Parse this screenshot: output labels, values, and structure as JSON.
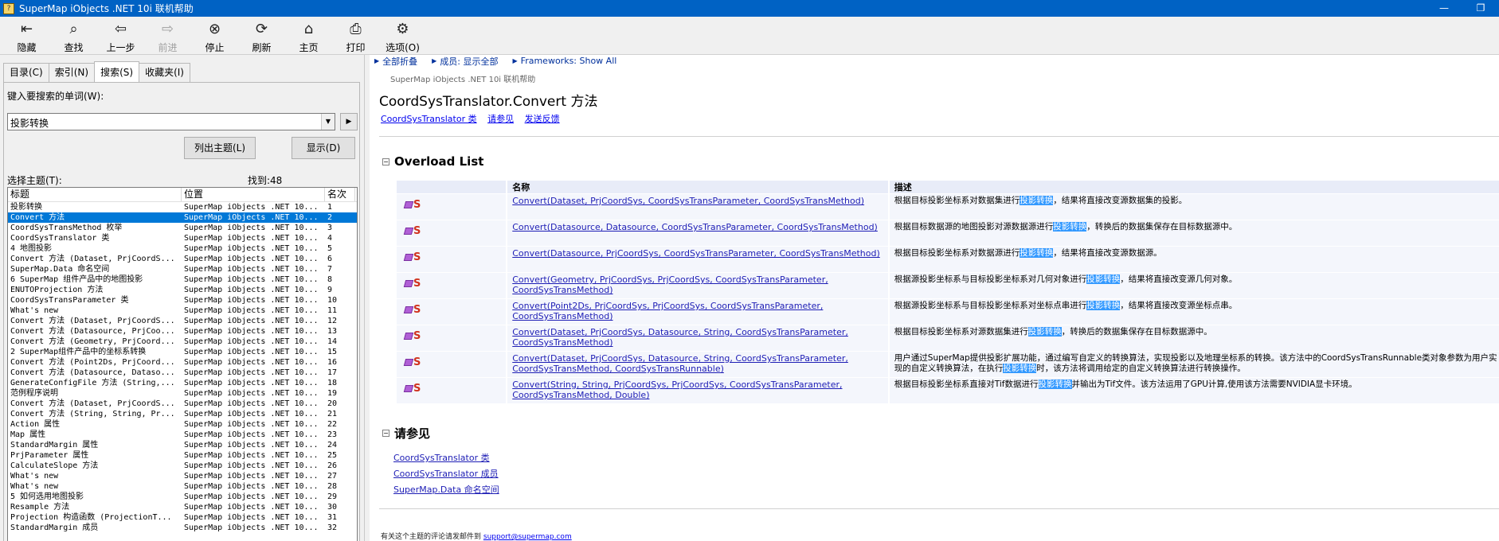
{
  "window": {
    "title": "SuperMap iObjects .NET 10i 联机帮助",
    "controls": [
      "minimize",
      "restore"
    ]
  },
  "toolbar": [
    {
      "id": "hide",
      "label": "隐藏",
      "icon": "hide-icon",
      "glyph": "⇤",
      "enabled": true
    },
    {
      "id": "find",
      "label": "查找",
      "icon": "find-icon",
      "glyph": "⌕",
      "enabled": true
    },
    {
      "id": "back",
      "label": "上一步",
      "icon": "back-arrow-icon",
      "glyph": "⇦",
      "enabled": true
    },
    {
      "id": "forward",
      "label": "前进",
      "icon": "forward-arrow-icon",
      "glyph": "⇨",
      "enabled": false
    },
    {
      "id": "stop",
      "label": "停止",
      "icon": "stop-icon",
      "glyph": "⊗",
      "enabled": true
    },
    {
      "id": "refresh",
      "label": "刷新",
      "icon": "refresh-icon",
      "glyph": "⟳",
      "enabled": true
    },
    {
      "id": "home",
      "label": "主页",
      "icon": "home-icon",
      "glyph": "⌂",
      "enabled": true
    },
    {
      "id": "print",
      "label": "打印",
      "icon": "print-icon",
      "glyph": "⎙",
      "enabled": true
    },
    {
      "id": "options",
      "label": "选项(O)",
      "icon": "options-icon",
      "glyph": "⚙",
      "enabled": true
    }
  ],
  "left": {
    "tabs": [
      {
        "label": "目录(C)",
        "active": false
      },
      {
        "label": "索引(N)",
        "active": false
      },
      {
        "label": "搜索(S)",
        "active": true
      },
      {
        "label": "收藏夹(I)",
        "active": false
      }
    ],
    "keyword_label": "键入要搜索的单词(W):",
    "keyword_value": "投影转换",
    "list_topics_button": "列出主题(L)",
    "display_button": "显示(D)",
    "select_topic_label": "选择主题(T):",
    "found_label": "找到:48",
    "columns": [
      "标题",
      "位置",
      "名次"
    ],
    "results": [
      {
        "title": "投影转换",
        "location": "SuperMap iObjects .NET 10...",
        "rank": "1"
      },
      {
        "title": "Convert 方法",
        "location": "SuperMap iObjects .NET 10...",
        "rank": "2",
        "selected": true
      },
      {
        "title": "CoordSysTransMethod 枚举",
        "location": "SuperMap iObjects .NET 10...",
        "rank": "3"
      },
      {
        "title": "CoordSysTranslator 类",
        "location": "SuperMap iObjects .NET 10...",
        "rank": "4"
      },
      {
        "title": "4 地图投影",
        "location": "SuperMap iObjects .NET 10...",
        "rank": "5"
      },
      {
        "title": "Convert 方法 (Dataset, PrjCoordS...",
        "location": "SuperMap iObjects .NET 10...",
        "rank": "6"
      },
      {
        "title": "SuperMap.Data 命名空间",
        "location": "SuperMap iObjects .NET 10...",
        "rank": "7"
      },
      {
        "title": "6 SuperMap 组件产品中的地图投影",
        "location": "SuperMap iObjects .NET 10...",
        "rank": "8"
      },
      {
        "title": "ENUTOProjection 方法",
        "location": "SuperMap iObjects .NET 10...",
        "rank": "9"
      },
      {
        "title": "CoordSysTransParameter 类",
        "location": "SuperMap iObjects .NET 10...",
        "rank": "10"
      },
      {
        "title": "What's new",
        "location": "SuperMap iObjects .NET 10...",
        "rank": "11"
      },
      {
        "title": "Convert 方法 (Dataset, PrjCoordS...",
        "location": "SuperMap iObjects .NET 10...",
        "rank": "12"
      },
      {
        "title": "Convert 方法 (Datasource, PrjCoo...",
        "location": "SuperMap iObjects .NET 10...",
        "rank": "13"
      },
      {
        "title": "Convert 方法 (Geometry, PrjCoord...",
        "location": "SuperMap iObjects .NET 10...",
        "rank": "14"
      },
      {
        "title": "2 SuperMap组件产品中的坐标系转换",
        "location": "SuperMap iObjects .NET 10...",
        "rank": "15"
      },
      {
        "title": "Convert 方法 (Point2Ds, PrjCoord...",
        "location": "SuperMap iObjects .NET 10...",
        "rank": "16"
      },
      {
        "title": "Convert 方法 (Datasource, Dataso...",
        "location": "SuperMap iObjects .NET 10...",
        "rank": "17"
      },
      {
        "title": "GenerateConfigFile 方法 (String,...",
        "location": "SuperMap iObjects .NET 10...",
        "rank": "18"
      },
      {
        "title": "范例程序说明",
        "location": "SuperMap iObjects .NET 10...",
        "rank": "19"
      },
      {
        "title": "Convert 方法 (Dataset, PrjCoordS...",
        "location": "SuperMap iObjects .NET 10...",
        "rank": "20"
      },
      {
        "title": "Convert 方法 (String, String, Pr...",
        "location": "SuperMap iObjects .NET 10...",
        "rank": "21"
      },
      {
        "title": "Action 属性",
        "location": "SuperMap iObjects .NET 10...",
        "rank": "22"
      },
      {
        "title": "Map 属性",
        "location": "SuperMap iObjects .NET 10...",
        "rank": "23"
      },
      {
        "title": "StandardMargin 属性",
        "location": "SuperMap iObjects .NET 10...",
        "rank": "24"
      },
      {
        "title": "PrjParameter 属性",
        "location": "SuperMap iObjects .NET 10...",
        "rank": "25"
      },
      {
        "title": "CalculateSlope 方法",
        "location": "SuperMap iObjects .NET 10...",
        "rank": "26"
      },
      {
        "title": "What's new",
        "location": "SuperMap iObjects .NET 10...",
        "rank": "27"
      },
      {
        "title": "What's new",
        "location": "SuperMap iObjects .NET 10...",
        "rank": "28"
      },
      {
        "title": "5 如何选用地图投影",
        "location": "SuperMap iObjects .NET 10...",
        "rank": "29"
      },
      {
        "title": "Resample 方法",
        "location": "SuperMap iObjects .NET 10...",
        "rank": "30"
      },
      {
        "title": "Projection 构造函数 (ProjectionT...",
        "location": "SuperMap iObjects .NET 10...",
        "rank": "31"
      },
      {
        "title": "StandardMargin 成员",
        "location": "SuperMap iObjects .NET 10...",
        "rank": "32"
      }
    ]
  },
  "content": {
    "topbar": [
      "全部折叠",
      "成员: 显示全部",
      "Frameworks: Show All"
    ],
    "brand": "SuperMap iObjects .NET 10i 联机帮助",
    "title": "CoordSysTranslator.Convert 方法",
    "links": [
      "CoordSysTranslator 类",
      "请参见",
      "发送反馈"
    ],
    "overload_heading": "Overload List",
    "table_headers": [
      "名称",
      "描述"
    ],
    "overloads": [
      {
        "name": "Convert(Dataset, PrjCoordSys, CoordSysTransParameter, CoordSysTransMethod)",
        "desc_pre": "根据目标投影坐标系对数据集进行",
        "desc_hl": "投影转换",
        "desc_post": "，结果将直接改变源数据集的投影。"
      },
      {
        "name": "Convert(Datasource, Datasource, CoordSysTransParameter, CoordSysTransMethod)",
        "desc_pre": "根据目标数据源的地图投影对源数据源进行",
        "desc_hl": "投影转换",
        "desc_post": "，转换后的数据集保存在目标数据源中。"
      },
      {
        "name": "Convert(Datasource, PrjCoordSys, CoordSysTransParameter, CoordSysTransMethod)",
        "desc_pre": "根据目标投影坐标系对数据源进行",
        "desc_hl": "投影转换",
        "desc_post": "，结果将直接改变源数据源。"
      },
      {
        "name": "Convert(Geometry, PrjCoordSys, PrjCoordSys, CoordSysTransParameter, CoordSysTransMethod)",
        "desc_pre": "根据源投影坐标系与目标投影坐标系对几何对象进行",
        "desc_hl": "投影转换",
        "desc_post": "，结果将直接改变源几何对象。"
      },
      {
        "name": "Convert(Point2Ds, PrjCoordSys, PrjCoordSys, CoordSysTransParameter, CoordSysTransMethod)",
        "desc_pre": "根据源投影坐标系与目标投影坐标系对坐标点串进行",
        "desc_hl": "投影转换",
        "desc_post": "，结果将直接改变源坐标点串。"
      },
      {
        "name": "Convert(Dataset, PrjCoordSys, Datasource, String, CoordSysTransParameter, CoordSysTransMethod)",
        "desc_pre": "根据目标投影坐标系对源数据集进行",
        "desc_hl": "投影转换",
        "desc_post": "，转换后的数据集保存在目标数据源中。"
      },
      {
        "name": "Convert(Dataset, PrjCoordSys, Datasource, String, CoordSysTransParameter, CoordSysTransMethod, CoordSysTransRunnable)",
        "desc_pre": "用户通过SuperMap提供投影扩展功能，通过编写自定义的转换算法，实现投影以及地理坐标系的转换。该方法中的CoordSysTransRunnable类对象参数为用户实现的自定义转换算法，在执行",
        "desc_hl": "投影转换",
        "desc_post": "时，该方法将调用给定的自定义转换算法进行转换操作。"
      },
      {
        "name": "Convert(String, String, PrjCoordSys, PrjCoordSys, CoordSysTransParameter, CoordSysTransMethod, Double)",
        "desc_pre": "根据目标投影坐标系直接对Tif数据进行",
        "desc_hl": "投影转换",
        "desc_post": "并输出为Tif文件。该方法运用了GPU计算,使用该方法需要NVIDIA显卡环境。"
      }
    ],
    "seealso_heading": "请参见",
    "seealso_links": [
      "CoordSysTranslator 类",
      "CoordSysTranslator 成员",
      "SuperMap.Data 命名空间"
    ],
    "footer_text": "有关这个主题的评论请发邮件到",
    "footer_email": "support@supermap.com"
  }
}
